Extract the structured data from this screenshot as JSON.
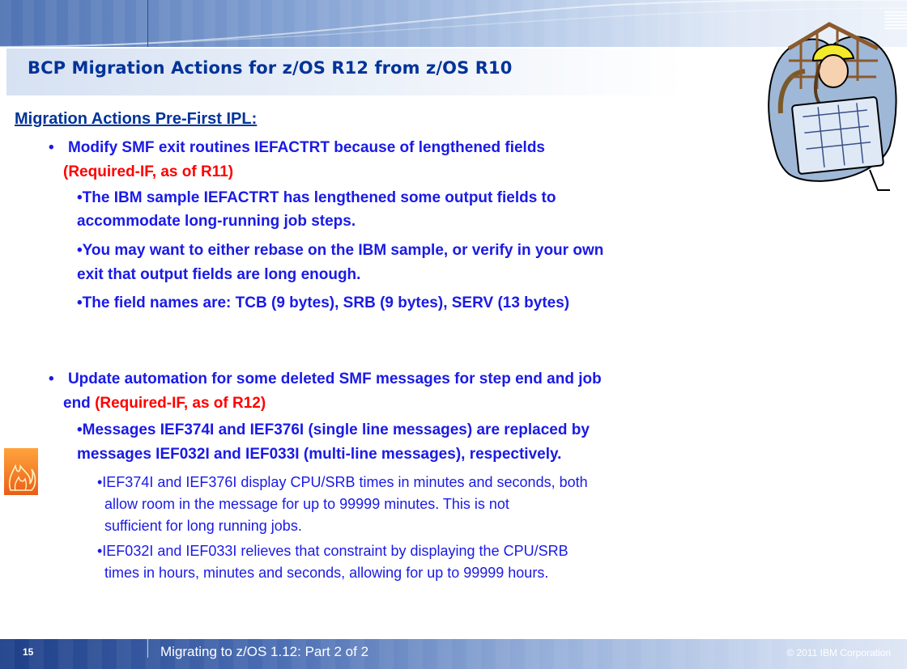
{
  "slide": {
    "title": "BCP Migration Actions for z/OS R12 from z/OS R10",
    "subheading": "Migration Actions Pre-First IPL:",
    "bullet1": {
      "line1": "Modify SMF exit routines IEFACTRT because of lengthened fields",
      "tag": "(Required-IF, as of R11)",
      "sub1_line1": "•The IBM sample IEFACTRT has lengthened some output fields to",
      "sub1_line2": "accommodate long-running job steps.",
      "sub2_line1": "•You may want to either rebase on the IBM sample, or verify in your own",
      "sub2_line2": "exit that output fields are long enough.",
      "sub3": "•The field names are:  TCB (9 bytes), SRB (9 bytes), SERV (13 bytes)"
    },
    "bullet2": {
      "line1": "Update automation for some deleted SMF messages for step end and job",
      "line2": "end",
      "tag": "(Required-IF, as of R12)",
      "sub1_line1": "•Messages IEF374I and IEF376I (single line messages) are replaced by",
      "sub1_line2": "messages IEF032I and IEF033I (multi-line messages), respectively.",
      "detail1_line1": "•IEF374I and IEF376I display CPU/SRB times in minutes and seconds, both",
      "detail1_line2": "allow room in the message for up to 99999 minutes. This is not",
      "detail1_line3": "sufficient for long running jobs.",
      "detail2_line1": "•IEF032I and IEF033I relieves that constraint by displaying the CPU/SRB",
      "detail2_line2": "times in hours, minutes and seconds, allowing for up to 99999 hours."
    },
    "bullet_glyph": "•"
  },
  "footer": {
    "page_number": "15",
    "presentation_title": "Migrating to z/OS 1.12:  Part 2 of 2",
    "copyright": "© 2011 IBM Corporation"
  },
  "icons": {
    "logo": "ibm-logo-icon",
    "clipart": "construction-worker-icon",
    "fire": "fire-icon"
  },
  "colors": {
    "title_blue": "#003399",
    "body_blue": "#1a1ae6",
    "required_red": "#ff0000"
  }
}
